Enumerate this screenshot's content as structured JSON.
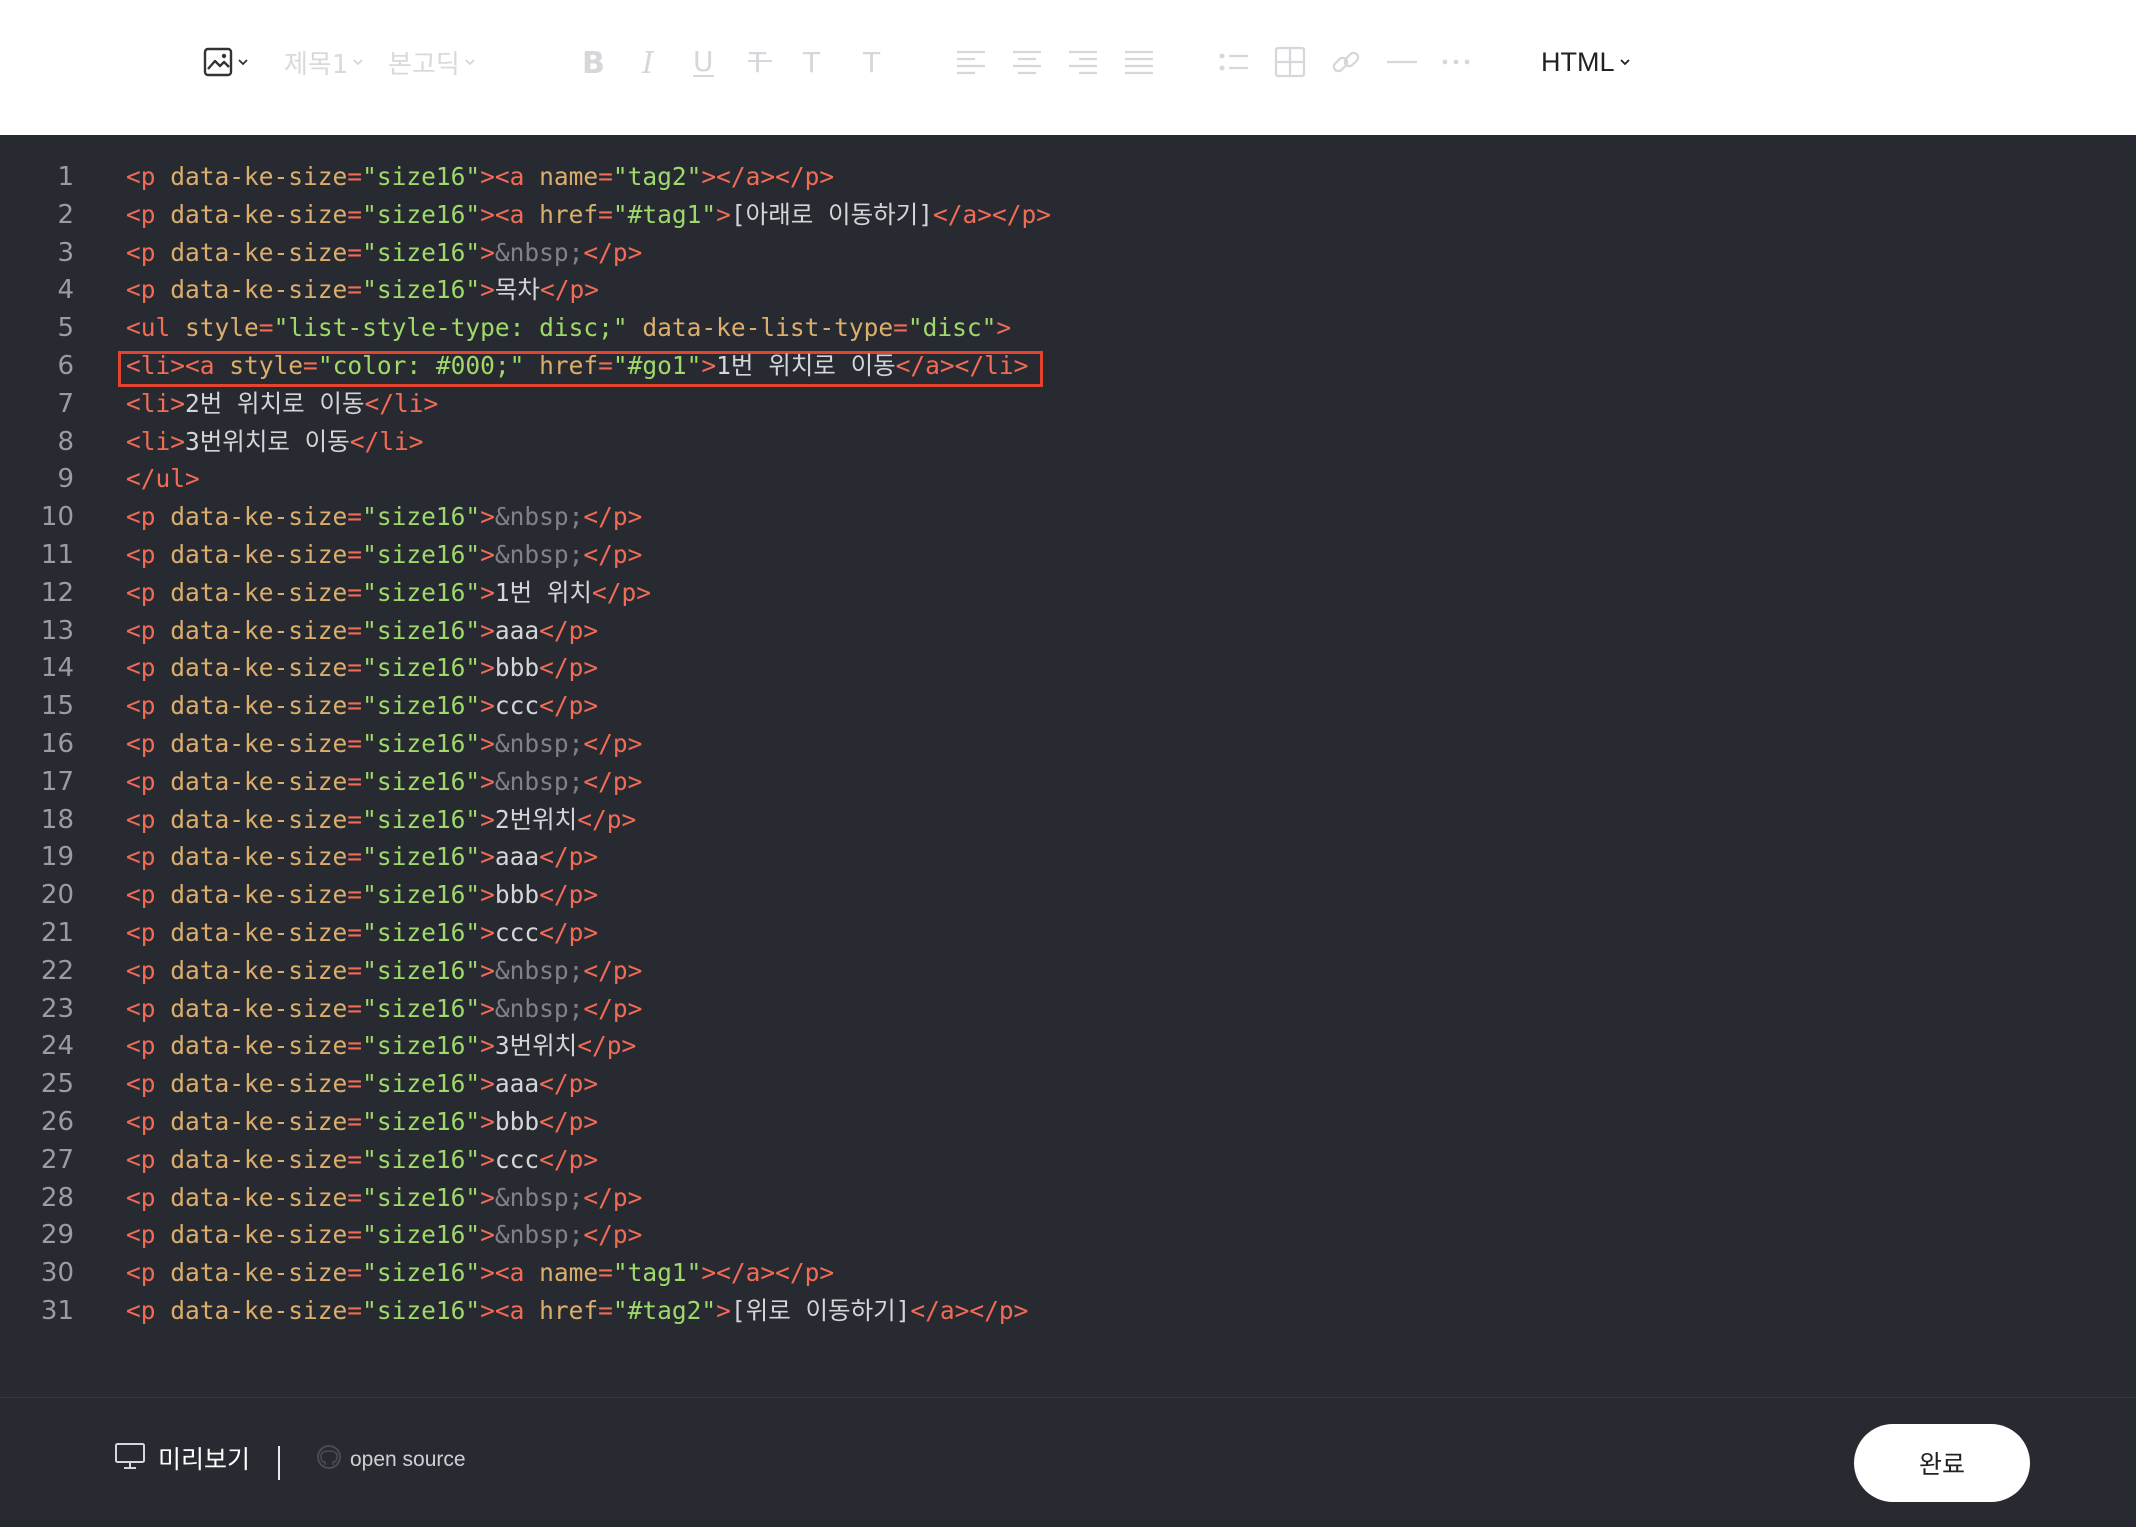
{
  "toolbar": {
    "image_icon": "image-icon",
    "heading_label": "제목1",
    "font_label": "본고딕",
    "mode_label": "HTML"
  },
  "editor": {
    "lines": [
      {
        "n": "1",
        "tokens": [
          [
            "tag",
            "<p"
          ],
          [
            "sp",
            " "
          ],
          [
            "attr",
            "data-ke-size"
          ],
          [
            "tag",
            "="
          ],
          [
            "val",
            "\"size16\""
          ],
          [
            "tag",
            "><a"
          ],
          [
            "sp",
            " "
          ],
          [
            "attr",
            "name"
          ],
          [
            "tag",
            "="
          ],
          [
            "val",
            "\"tag2\""
          ],
          [
            "tag",
            "></a></p>"
          ]
        ]
      },
      {
        "n": "2",
        "tokens": [
          [
            "tag",
            "<p"
          ],
          [
            "sp",
            " "
          ],
          [
            "attr",
            "data-ke-size"
          ],
          [
            "tag",
            "="
          ],
          [
            "val",
            "\"size16\""
          ],
          [
            "tag",
            "><a"
          ],
          [
            "sp",
            " "
          ],
          [
            "attr",
            "href"
          ],
          [
            "tag",
            "="
          ],
          [
            "val",
            "\"#tag1\""
          ],
          [
            "tag",
            ">"
          ],
          [
            "txt",
            "[아래로 이동하기]"
          ],
          [
            "tag",
            "</a></p>"
          ]
        ]
      },
      {
        "n": "3",
        "tokens": [
          [
            "tag",
            "<p"
          ],
          [
            "sp",
            " "
          ],
          [
            "attr",
            "data-ke-size"
          ],
          [
            "tag",
            "="
          ],
          [
            "val",
            "\"size16\""
          ],
          [
            "tag",
            ">"
          ],
          [
            "ent",
            "&nbsp;"
          ],
          [
            "tag",
            "</p>"
          ]
        ]
      },
      {
        "n": "4",
        "tokens": [
          [
            "tag",
            "<p"
          ],
          [
            "sp",
            " "
          ],
          [
            "attr",
            "data-ke-size"
          ],
          [
            "tag",
            "="
          ],
          [
            "val",
            "\"size16\""
          ],
          [
            "tag",
            ">"
          ],
          [
            "txt",
            "목차"
          ],
          [
            "tag",
            "</p>"
          ]
        ]
      },
      {
        "n": "5",
        "tokens": [
          [
            "tag",
            "<ul"
          ],
          [
            "sp",
            " "
          ],
          [
            "attr",
            "style"
          ],
          [
            "tag",
            "="
          ],
          [
            "val",
            "\"list-style-type: disc;\""
          ],
          [
            "sp",
            " "
          ],
          [
            "attr",
            "data-ke-list-type"
          ],
          [
            "tag",
            "="
          ],
          [
            "val",
            "\"disc\""
          ],
          [
            "tag",
            ">"
          ]
        ]
      },
      {
        "n": "6",
        "tokens": [
          [
            "tag",
            "<li><a"
          ],
          [
            "sp",
            " "
          ],
          [
            "attr",
            "style"
          ],
          [
            "tag",
            "="
          ],
          [
            "val",
            "\"color: #000;\""
          ],
          [
            "sp",
            " "
          ],
          [
            "attr",
            "href"
          ],
          [
            "tag",
            "="
          ],
          [
            "val",
            "\"#go1\""
          ],
          [
            "tag",
            ">"
          ],
          [
            "txt",
            "1번 위치로 이동"
          ],
          [
            "tag",
            "</a></li>"
          ]
        ]
      },
      {
        "n": "7",
        "tokens": [
          [
            "tag",
            "<li>"
          ],
          [
            "txt",
            "2번 위치로 이동"
          ],
          [
            "tag",
            "</li>"
          ]
        ]
      },
      {
        "n": "8",
        "tokens": [
          [
            "tag",
            "<li>"
          ],
          [
            "txt",
            "3번위치로 이동"
          ],
          [
            "tag",
            "</li>"
          ]
        ]
      },
      {
        "n": "9",
        "tokens": [
          [
            "tag",
            "</ul>"
          ]
        ]
      },
      {
        "n": "10",
        "tokens": [
          [
            "tag",
            "<p"
          ],
          [
            "sp",
            " "
          ],
          [
            "attr",
            "data-ke-size"
          ],
          [
            "tag",
            "="
          ],
          [
            "val",
            "\"size16\""
          ],
          [
            "tag",
            ">"
          ],
          [
            "ent",
            "&nbsp;"
          ],
          [
            "tag",
            "</p>"
          ]
        ]
      },
      {
        "n": "11",
        "tokens": [
          [
            "tag",
            "<p"
          ],
          [
            "sp",
            " "
          ],
          [
            "attr",
            "data-ke-size"
          ],
          [
            "tag",
            "="
          ],
          [
            "val",
            "\"size16\""
          ],
          [
            "tag",
            ">"
          ],
          [
            "ent",
            "&nbsp;"
          ],
          [
            "tag",
            "</p>"
          ]
        ]
      },
      {
        "n": "12",
        "tokens": [
          [
            "tag",
            "<p"
          ],
          [
            "sp",
            " "
          ],
          [
            "attr",
            "data-ke-size"
          ],
          [
            "tag",
            "="
          ],
          [
            "val",
            "\"size16\""
          ],
          [
            "tag",
            ">"
          ],
          [
            "txt",
            "1번 위치"
          ],
          [
            "tag",
            "</p>"
          ]
        ]
      },
      {
        "n": "13",
        "tokens": [
          [
            "tag",
            "<p"
          ],
          [
            "sp",
            " "
          ],
          [
            "attr",
            "data-ke-size"
          ],
          [
            "tag",
            "="
          ],
          [
            "val",
            "\"size16\""
          ],
          [
            "tag",
            ">"
          ],
          [
            "txt",
            "aaa"
          ],
          [
            "tag",
            "</p>"
          ]
        ]
      },
      {
        "n": "14",
        "tokens": [
          [
            "tag",
            "<p"
          ],
          [
            "sp",
            " "
          ],
          [
            "attr",
            "data-ke-size"
          ],
          [
            "tag",
            "="
          ],
          [
            "val",
            "\"size16\""
          ],
          [
            "tag",
            ">"
          ],
          [
            "txt",
            "bbb"
          ],
          [
            "tag",
            "</p>"
          ]
        ]
      },
      {
        "n": "15",
        "tokens": [
          [
            "tag",
            "<p"
          ],
          [
            "sp",
            " "
          ],
          [
            "attr",
            "data-ke-size"
          ],
          [
            "tag",
            "="
          ],
          [
            "val",
            "\"size16\""
          ],
          [
            "tag",
            ">"
          ],
          [
            "txt",
            "ccc"
          ],
          [
            "tag",
            "</p>"
          ]
        ]
      },
      {
        "n": "16",
        "tokens": [
          [
            "tag",
            "<p"
          ],
          [
            "sp",
            " "
          ],
          [
            "attr",
            "data-ke-size"
          ],
          [
            "tag",
            "="
          ],
          [
            "val",
            "\"size16\""
          ],
          [
            "tag",
            ">"
          ],
          [
            "ent",
            "&nbsp;"
          ],
          [
            "tag",
            "</p>"
          ]
        ]
      },
      {
        "n": "17",
        "tokens": [
          [
            "tag",
            "<p"
          ],
          [
            "sp",
            " "
          ],
          [
            "attr",
            "data-ke-size"
          ],
          [
            "tag",
            "="
          ],
          [
            "val",
            "\"size16\""
          ],
          [
            "tag",
            ">"
          ],
          [
            "ent",
            "&nbsp;"
          ],
          [
            "tag",
            "</p>"
          ]
        ]
      },
      {
        "n": "18",
        "tokens": [
          [
            "tag",
            "<p"
          ],
          [
            "sp",
            " "
          ],
          [
            "attr",
            "data-ke-size"
          ],
          [
            "tag",
            "="
          ],
          [
            "val",
            "\"size16\""
          ],
          [
            "tag",
            ">"
          ],
          [
            "txt",
            "2번위치"
          ],
          [
            "tag",
            "</p>"
          ]
        ]
      },
      {
        "n": "19",
        "tokens": [
          [
            "tag",
            "<p"
          ],
          [
            "sp",
            " "
          ],
          [
            "attr",
            "data-ke-size"
          ],
          [
            "tag",
            "="
          ],
          [
            "val",
            "\"size16\""
          ],
          [
            "tag",
            ">"
          ],
          [
            "txt",
            "aaa"
          ],
          [
            "tag",
            "</p>"
          ]
        ]
      },
      {
        "n": "20",
        "tokens": [
          [
            "tag",
            "<p"
          ],
          [
            "sp",
            " "
          ],
          [
            "attr",
            "data-ke-size"
          ],
          [
            "tag",
            "="
          ],
          [
            "val",
            "\"size16\""
          ],
          [
            "tag",
            ">"
          ],
          [
            "txt",
            "bbb"
          ],
          [
            "tag",
            "</p>"
          ]
        ]
      },
      {
        "n": "21",
        "tokens": [
          [
            "tag",
            "<p"
          ],
          [
            "sp",
            " "
          ],
          [
            "attr",
            "data-ke-size"
          ],
          [
            "tag",
            "="
          ],
          [
            "val",
            "\"size16\""
          ],
          [
            "tag",
            ">"
          ],
          [
            "txt",
            "ccc"
          ],
          [
            "tag",
            "</p>"
          ]
        ]
      },
      {
        "n": "22",
        "tokens": [
          [
            "tag",
            "<p"
          ],
          [
            "sp",
            " "
          ],
          [
            "attr",
            "data-ke-size"
          ],
          [
            "tag",
            "="
          ],
          [
            "val",
            "\"size16\""
          ],
          [
            "tag",
            ">"
          ],
          [
            "ent",
            "&nbsp;"
          ],
          [
            "tag",
            "</p>"
          ]
        ]
      },
      {
        "n": "23",
        "tokens": [
          [
            "tag",
            "<p"
          ],
          [
            "sp",
            " "
          ],
          [
            "attr",
            "data-ke-size"
          ],
          [
            "tag",
            "="
          ],
          [
            "val",
            "\"size16\""
          ],
          [
            "tag",
            ">"
          ],
          [
            "ent",
            "&nbsp;"
          ],
          [
            "tag",
            "</p>"
          ]
        ]
      },
      {
        "n": "24",
        "tokens": [
          [
            "tag",
            "<p"
          ],
          [
            "sp",
            " "
          ],
          [
            "attr",
            "data-ke-size"
          ],
          [
            "tag",
            "="
          ],
          [
            "val",
            "\"size16\""
          ],
          [
            "tag",
            ">"
          ],
          [
            "txt",
            "3번위치"
          ],
          [
            "tag",
            "</p>"
          ]
        ]
      },
      {
        "n": "25",
        "tokens": [
          [
            "tag",
            "<p"
          ],
          [
            "sp",
            " "
          ],
          [
            "attr",
            "data-ke-size"
          ],
          [
            "tag",
            "="
          ],
          [
            "val",
            "\"size16\""
          ],
          [
            "tag",
            ">"
          ],
          [
            "txt",
            "aaa"
          ],
          [
            "tag",
            "</p>"
          ]
        ]
      },
      {
        "n": "26",
        "tokens": [
          [
            "tag",
            "<p"
          ],
          [
            "sp",
            " "
          ],
          [
            "attr",
            "data-ke-size"
          ],
          [
            "tag",
            "="
          ],
          [
            "val",
            "\"size16\""
          ],
          [
            "tag",
            ">"
          ],
          [
            "txt",
            "bbb"
          ],
          [
            "tag",
            "</p>"
          ]
        ]
      },
      {
        "n": "27",
        "tokens": [
          [
            "tag",
            "<p"
          ],
          [
            "sp",
            " "
          ],
          [
            "attr",
            "data-ke-size"
          ],
          [
            "tag",
            "="
          ],
          [
            "val",
            "\"size16\""
          ],
          [
            "tag",
            ">"
          ],
          [
            "txt",
            "ccc"
          ],
          [
            "tag",
            "</p>"
          ]
        ]
      },
      {
        "n": "28",
        "tokens": [
          [
            "tag",
            "<p"
          ],
          [
            "sp",
            " "
          ],
          [
            "attr",
            "data-ke-size"
          ],
          [
            "tag",
            "="
          ],
          [
            "val",
            "\"size16\""
          ],
          [
            "tag",
            ">"
          ],
          [
            "ent",
            "&nbsp;"
          ],
          [
            "tag",
            "</p>"
          ]
        ]
      },
      {
        "n": "29",
        "tokens": [
          [
            "tag",
            "<p"
          ],
          [
            "sp",
            " "
          ],
          [
            "attr",
            "data-ke-size"
          ],
          [
            "tag",
            "="
          ],
          [
            "val",
            "\"size16\""
          ],
          [
            "tag",
            ">"
          ],
          [
            "ent",
            "&nbsp;"
          ],
          [
            "tag",
            "</p>"
          ]
        ]
      },
      {
        "n": "30",
        "tokens": [
          [
            "tag",
            "<p"
          ],
          [
            "sp",
            " "
          ],
          [
            "attr",
            "data-ke-size"
          ],
          [
            "tag",
            "="
          ],
          [
            "val",
            "\"size16\""
          ],
          [
            "tag",
            "><a"
          ],
          [
            "sp",
            " "
          ],
          [
            "attr",
            "name"
          ],
          [
            "tag",
            "="
          ],
          [
            "val",
            "\"tag1\""
          ],
          [
            "tag",
            "></a></p>"
          ]
        ]
      },
      {
        "n": "31",
        "tokens": [
          [
            "tag",
            "<p"
          ],
          [
            "sp",
            " "
          ],
          [
            "attr",
            "data-ke-size"
          ],
          [
            "tag",
            "="
          ],
          [
            "val",
            "\"size16\""
          ],
          [
            "tag",
            "><a"
          ],
          [
            "sp",
            " "
          ],
          [
            "attr",
            "href"
          ],
          [
            "tag",
            "="
          ],
          [
            "val",
            "\"#tag2\""
          ],
          [
            "tag",
            ">"
          ],
          [
            "txt",
            "[위로 이동하기]"
          ],
          [
            "tag",
            "</a></p>"
          ]
        ]
      }
    ],
    "highlighted_line": "6",
    "colors": {
      "tag": "#f26b55",
      "attr": "#dcae6c",
      "value": "#9ed96a",
      "text": "#d4d5d8",
      "entity": "#7f828a",
      "highlight_border": "#e2442f",
      "background": "#282a31"
    }
  },
  "footer": {
    "preview_label": "미리보기",
    "preview_icon": "monitor-icon",
    "open_source_label": "open source",
    "open_source_icon": "github-icon",
    "done_label": "완료"
  }
}
